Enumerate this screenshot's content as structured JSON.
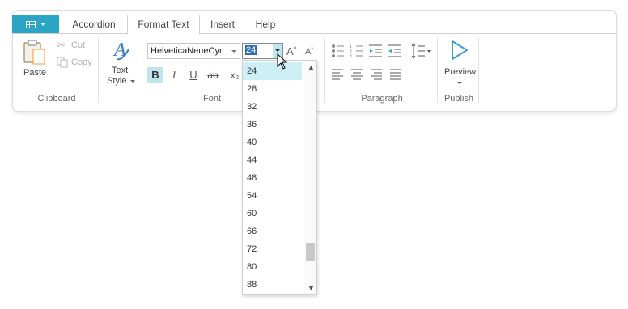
{
  "tabs": [
    "Accordion",
    "Format Text",
    "Insert",
    "Help"
  ],
  "active_tab": "Format Text",
  "clipboard": {
    "paste": "Paste",
    "cut": "Cut",
    "copy": "Copy",
    "group": "Clipboard"
  },
  "textstyle": {
    "line1": "Text",
    "line2": "Style"
  },
  "font": {
    "family": "HelveticaNeueCyr",
    "size": "24",
    "group": "Font",
    "bold": "B",
    "italic": "I",
    "underline": "U",
    "strike": "ab",
    "subscript": "x₂",
    "grow": "A",
    "shrink": "A"
  },
  "paragraph": {
    "group": "Paragraph"
  },
  "publish": {
    "preview": "Preview",
    "group": "Publish"
  },
  "size_options": [
    "24",
    "28",
    "32",
    "36",
    "40",
    "44",
    "48",
    "54",
    "60",
    "66",
    "72",
    "80",
    "88"
  ],
  "selected_size": "24",
  "colors": {
    "accent": "#2aa5c6",
    "selection": "#ccf0f6",
    "play": "#3a9ad9"
  }
}
